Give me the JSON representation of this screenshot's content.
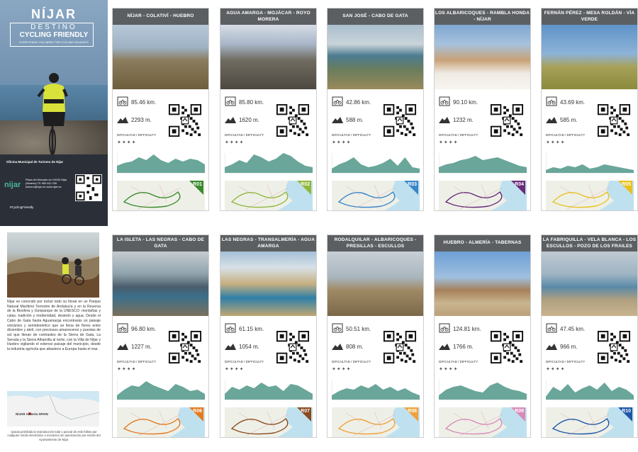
{
  "cover": {
    "brand": "NÍJAR",
    "destino": "DESTINO",
    "cycling_friendly": "CYCLING FRIENDLY",
    "tagline": "EVERYTHING YOU NEED FOR CYCLING HOLIDAYS",
    "office": "Oficina Municipal de Turismo de Níjar",
    "nijar_logo": "nijar",
    "address": "Plaza del Mercado s/n 04100 Níjar (Almería) Tlf. 950 612 239 turismo@nijar.es www.nijar.es",
    "hashtag": "#CyclingFriendly"
  },
  "intro": {
    "text": "Níjar es conocido por incluir todo su litoral en un Parque Natural Marítimo Terrestre de Andalucía y en la Reserva de la Biosfera y Geoparque de la UNESCO: montañas y calas, tradición y modernidad, desierto y agua. Desde el Cabo de Gata hasta Aguamarga encontrarás un paisaje volcánico y semidesértico que se llena de flores entre diciembre y abril, con preciosos amaneceres y puestas de sol que llenan de contrastes de la Sierra de Gata, La Serrata y la Sierra Alhamilla al norte, con la Villa de Níjar y Huebro vigilando el extenso paisaje del municipio, desde la industria agrícola que abastece a Europa hasta el mar.",
    "map_label": "NÍJAR Almería SPAIN",
    "footer": "Queda prohibida la reproducción total o parcial de este folleto por cualquier medio electrónico o mecánico sin autorización por escrito del Ayuntamiento de Níjar."
  },
  "labels": {
    "difficulty": "DIFICULTAD / DIFFICULTY"
  },
  "routes": [
    {
      "title": "NÍJAR - COLATIVÍ - HUEBRO",
      "distance": "85.46 km.",
      "elevation": "2293 m.",
      "code": "R01",
      "color": "#3a8a2e"
    },
    {
      "title": "AGUA AMARGA - MOJÁCAR - ROYO MORERA",
      "distance": "85.80 km.",
      "elevation": "1620 m.",
      "code": "R02",
      "color": "#8fb83a"
    },
    {
      "title": "SAN JOSÉ - CABO DE GATA",
      "distance": "42.86 km.",
      "elevation": "588 m.",
      "code": "R03",
      "color": "#3a86c8"
    },
    {
      "title": "LOS ALBARICOQUES - RAMBLA HONDA - NÍJAR",
      "distance": "90.10 km.",
      "elevation": "1232 m.",
      "code": "R04",
      "color": "#6a2a7a"
    },
    {
      "title": "FERNÁN PÉREZ - MESA ROLDÁN - VÍA VERDE",
      "distance": "43.69 km.",
      "elevation": "585 m.",
      "code": "R05",
      "color": "#e8c21c"
    },
    {
      "title": "LA ISLETA - LAS NEGRAS - CABO DE GATA",
      "distance": "96.80 km.",
      "elevation": "1227 m.",
      "code": "R06",
      "color": "#e57a1e"
    },
    {
      "title": "LAS NEGRAS - TRANSALMERÍA - AGUA AMARGA",
      "distance": "61.15 km.",
      "elevation": "1054 m.",
      "code": "R07",
      "color": "#8a4a1e"
    },
    {
      "title": "RODALQUILAR - ALBARICOQUES - PRESILLAS - ESCULLOS",
      "distance": "50.51 km.",
      "elevation": "808 m.",
      "code": "R08",
      "color": "#f0a23a"
    },
    {
      "title": "HUEBRO - ALMERÍA - TABERNAS",
      "distance": "124.81 km.",
      "elevation": "1766 m.",
      "code": "R09",
      "color": "#d98ab8"
    },
    {
      "title": "LA FABRIQUILLA - VELA BLANCA - LOS ESCULLOS - POZO DE LOS FRAILES",
      "distance": "47.45 km.",
      "elevation": "966 m.",
      "code": "R10",
      "color": "#1e56a8"
    }
  ],
  "colors": {
    "header": "#5c5f62",
    "profile": "#6aa69a",
    "accent": "#49b6a0"
  }
}
